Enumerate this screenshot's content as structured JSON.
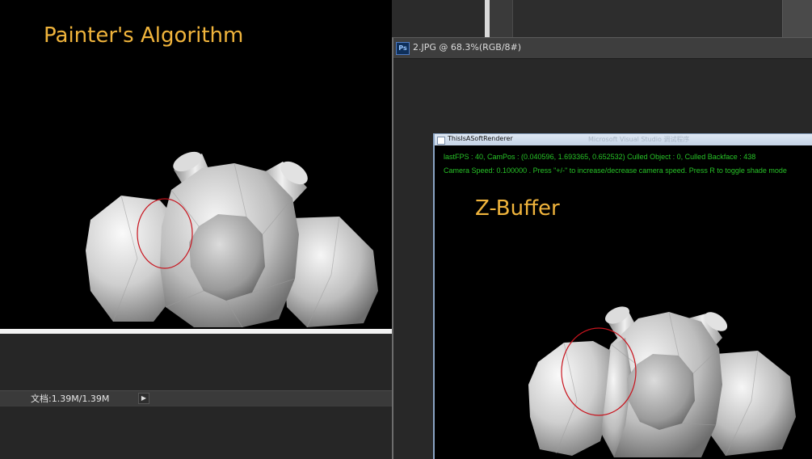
{
  "labels": {
    "painters": "Painter's Algorithm",
    "zbuffer": "Z-Buffer"
  },
  "left_window": {
    "status_doc": "文档:1.39M/1.39M",
    "arrow": "▶"
  },
  "ps_window": {
    "logo": "Ps",
    "title": "2.JPG @ 68.3%(RGB/8#)"
  },
  "app_window": {
    "title": "ThisIsASoftRenderer",
    "faint_title": "Microsoft Visual Studio 调试程序",
    "info_line1": "lastFPS : 40, CamPos : (0.040596, 1.693365, 0.652532)       Culled Object : 0, Culled Backface : 438",
    "info_line2": "Camera Speed: 0.100000 . Press \"+/-\" to increase/decrease camera speed. Press R to toggle shade mode"
  },
  "colors": {
    "label": "#f0b43c",
    "info_text": "#27c227",
    "highlight_circle": "#c8141e"
  },
  "icons": {
    "ps_logo": "photoshop-icon",
    "status_arrow": "triangle-right-icon"
  }
}
